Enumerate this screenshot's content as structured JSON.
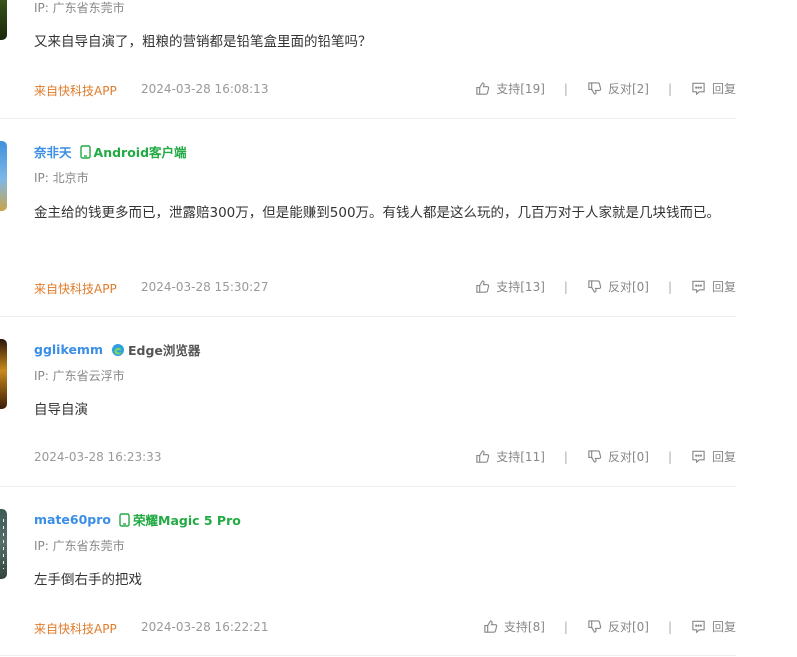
{
  "comments": [
    {
      "ip": "IP: 广东省东莞市",
      "text": "又来自导自演了，粗粮的营销都是铅笔盒里面的铅笔吗？",
      "source": "来自快科技APP",
      "time": "2024-03-28 16:08:13",
      "support": "支持[19]",
      "oppose": "反对[2]",
      "reply": "回复"
    },
    {
      "username": "奈非天",
      "device": "Android客户端",
      "ip": "IP: 北京市",
      "text": "金主给的钱更多而已，泄露赔300万，但是能赚到500万。有钱人都是这么玩的，几百万对于人家就是几块钱而已。",
      "source": "来自快科技APP",
      "time": "2024-03-28 15:30:27",
      "support": "支持[13]",
      "oppose": "反对[0]",
      "reply": "回复"
    },
    {
      "username": "gglikemm",
      "device": "Edge浏览器",
      "ip": "IP: 广东省云浮市",
      "text": "自导自演",
      "time": "2024-03-28 16:23:33",
      "support": "支持[11]",
      "oppose": "反对[0]",
      "reply": "回复"
    },
    {
      "username": "mate60pro",
      "device": "荣耀Magic 5 Pro",
      "ip": "IP: 广东省东莞市",
      "text": "左手倒右手的把戏",
      "source": "来自快科技APP",
      "time": "2024-03-28 16:22:21",
      "support": "支持[8]",
      "oppose": "反对[0]",
      "reply": "回复"
    }
  ],
  "colors": {
    "username": "#3a8ee6",
    "device_app": "#22aa44",
    "source": "#e07b2a",
    "divider": "#eeeeee"
  },
  "icons": [
    "phone-icon",
    "edge-icon",
    "thumbs-up-icon",
    "thumbs-down-icon",
    "comment-icon"
  ]
}
